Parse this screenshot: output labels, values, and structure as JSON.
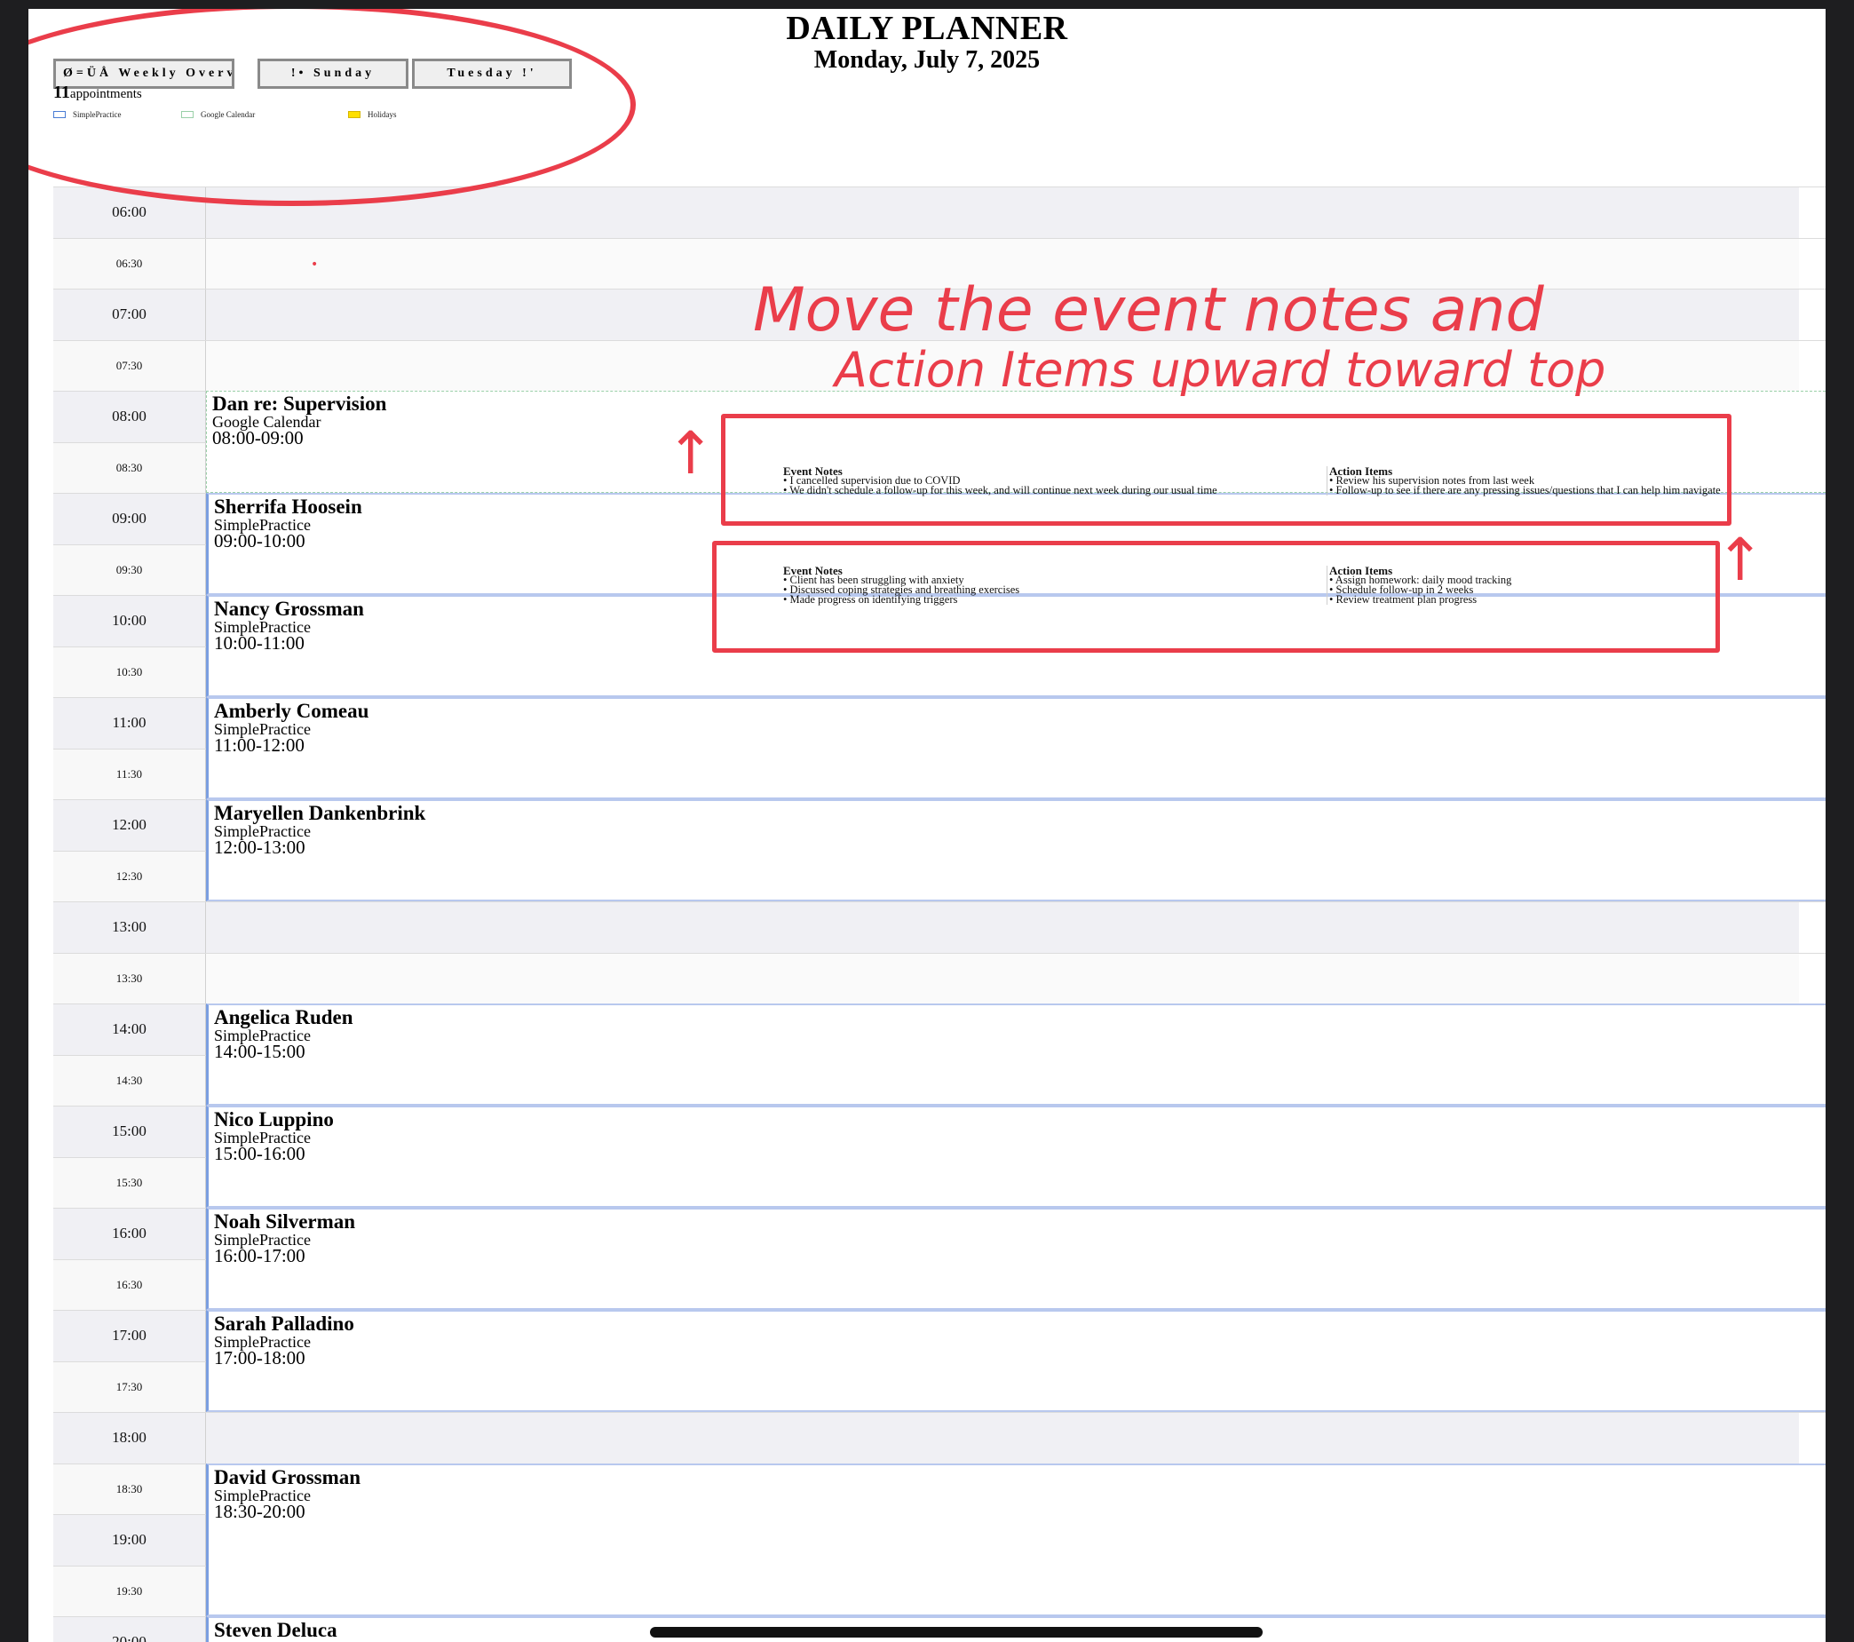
{
  "header": {
    "title": "DAILY PLANNER",
    "date": "Monday, July 7, 2025"
  },
  "nav": {
    "weekly": "Ø=ÜÅ Weekly Overview",
    "prev": "!• Sunday",
    "next": "Tuesday !'"
  },
  "summary": {
    "count": "11",
    "label": "appointments"
  },
  "legend": [
    {
      "label": "SimplePractice",
      "border": "#4a7cd4",
      "fill": "#ffffff"
    },
    {
      "label": "Google Calendar",
      "border": "#9ad0a8",
      "fill": "#ffffff"
    },
    {
      "label": "Holidays",
      "border": "#d6b600",
      "fill": "#ffe000"
    }
  ],
  "times": [
    "06:00",
    "06:30",
    "07:00",
    "07:30",
    "08:00",
    "08:30",
    "09:00",
    "09:30",
    "10:00",
    "10:30",
    "11:00",
    "11:30",
    "12:00",
    "12:30",
    "13:00",
    "13:30",
    "14:00",
    "14:30",
    "15:00",
    "15:30",
    "16:00",
    "16:30",
    "17:00",
    "17:30",
    "18:00",
    "18:30",
    "19:00",
    "19:30",
    "20:00"
  ],
  "events": [
    {
      "name": "Dan re: Supervision",
      "source": "Google Calendar",
      "time": "08:00-09:00",
      "kind": "gcal"
    },
    {
      "name": "Sherrifa Hoosein",
      "source": "SimplePractice",
      "time": "09:00-10:00",
      "kind": "sp"
    },
    {
      "name": "Nancy Grossman",
      "source": "SimplePractice",
      "time": "10:00-11:00",
      "kind": "sp"
    },
    {
      "name": "Amberly Comeau",
      "source": "SimplePractice",
      "time": "11:00-12:00",
      "kind": "sp"
    },
    {
      "name": "Maryellen Dankenbrink",
      "source": "SimplePractice",
      "time": "12:00-13:00",
      "kind": "sp"
    },
    {
      "name": "Angelica Ruden",
      "source": "SimplePractice",
      "time": "14:00-15:00",
      "kind": "sp"
    },
    {
      "name": "Nico Luppino",
      "source": "SimplePractice",
      "time": "15:00-16:00",
      "kind": "sp"
    },
    {
      "name": "Noah Silverman",
      "source": "SimplePractice",
      "time": "16:00-17:00",
      "kind": "sp"
    },
    {
      "name": "Sarah Palladino",
      "source": "SimplePractice",
      "time": "17:00-18:00",
      "kind": "sp"
    },
    {
      "name": "David Grossman",
      "source": "SimplePractice",
      "time": "18:30-20:00",
      "kind": "sp"
    },
    {
      "name": "Steven Deluca",
      "source": "",
      "time": "",
      "kind": "sp"
    }
  ],
  "notes": [
    {
      "event_notes_header": "Event Notes",
      "event_notes": [
        "• I cancelled supervision due to COVID",
        "• We didn't schedule a follow-up for this week, and will continue next week during our usual time"
      ],
      "action_items_header": "Action Items",
      "action_items": [
        "• Review his supervision notes from last week",
        "• Follow-up to see if there are any pressing issues/questions that I can help him navigate"
      ]
    },
    {
      "event_notes_header": "Event Notes",
      "event_notes": [
        "• Client has been struggling with anxiety",
        "• Discussed coping strategies and breathing exercises",
        "• Made progress on identifying triggers"
      ],
      "action_items_header": "Action Items",
      "action_items": [
        "• Assign homework: daily mood tracking",
        "• Schedule follow-up in 2 weeks",
        "• Review treatment plan progress"
      ]
    }
  ],
  "annotation": {
    "line1": "Move the event notes  and",
    "line2": "Action Items upward toward top",
    "arrow": "↑",
    "color": "#ea3d4a"
  }
}
